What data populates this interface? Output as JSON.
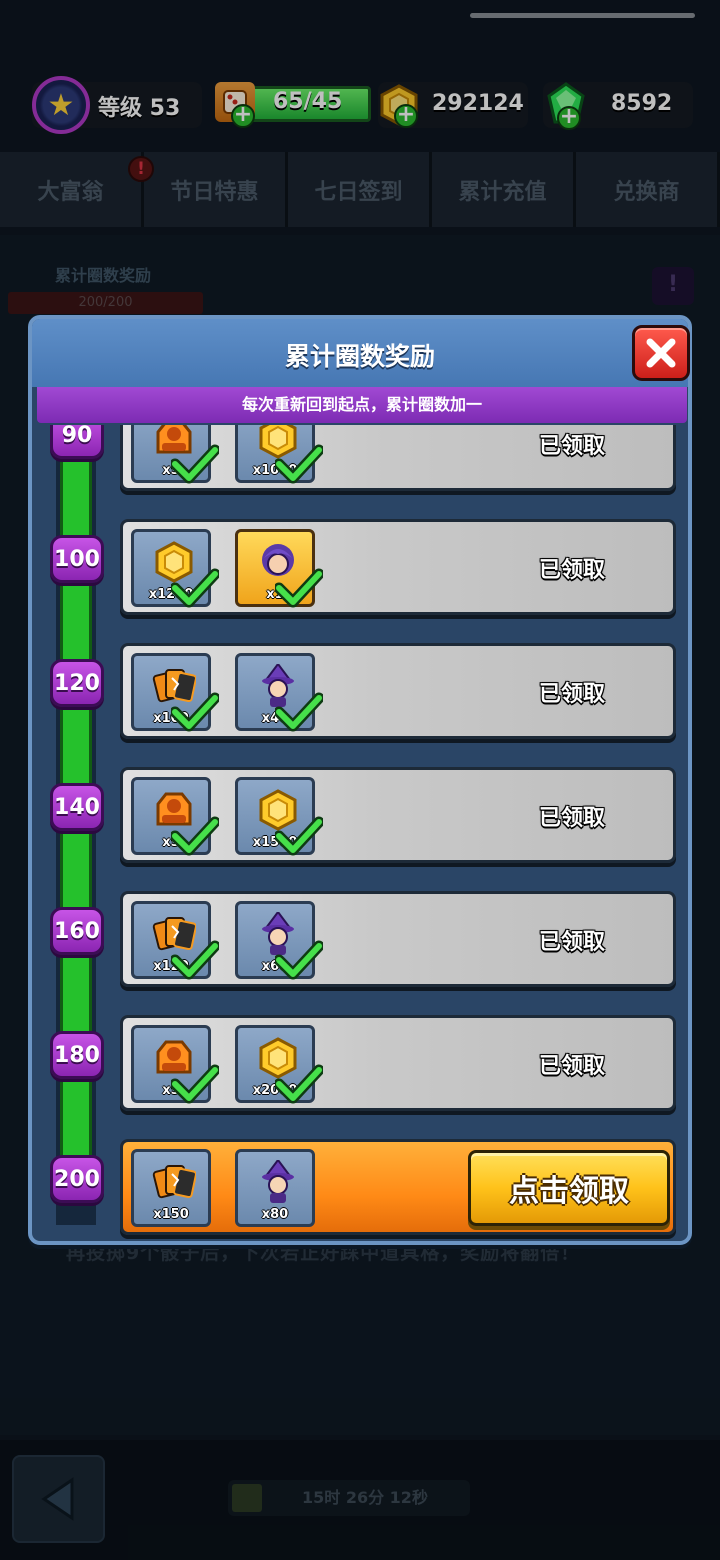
{
  "topbar": {
    "level_label": "等级 53",
    "energy": "65/45",
    "coins": "292124",
    "gems": "8592"
  },
  "tabs": [
    "大富翁",
    "节日特惠",
    "七日签到",
    "累计充值",
    "兑换商"
  ],
  "background": {
    "panel_title": "累计圈数奖励",
    "progress": "200/200",
    "hint": "再投掷9个骰子后，下次若正好踩中道具格，奖励将翻倍！",
    "timer": "15时 26分 12秒"
  },
  "modal": {
    "title": "累计圈数奖励",
    "subtitle": "每次重新回到起点，累计圈数加一",
    "rows": [
      {
        "milestone": "90",
        "items": [
          {
            "icon": "hero-card-icon",
            "qty": "x5"
          },
          {
            "icon": "gold-coin-icon",
            "qty": "x1000"
          }
        ],
        "status": "已领取"
      },
      {
        "milestone": "100",
        "items": [
          {
            "icon": "gold-coin-icon",
            "qty": "x1200"
          },
          {
            "icon": "hero-portrait-icon",
            "qty": "x1"
          }
        ],
        "status": "已领取"
      },
      {
        "milestone": "120",
        "items": [
          {
            "icon": "card-pack-icon",
            "qty": "x100"
          },
          {
            "icon": "witch-character-icon",
            "qty": "x40"
          }
        ],
        "status": "已领取"
      },
      {
        "milestone": "140",
        "items": [
          {
            "icon": "hero-card-icon",
            "qty": "x5"
          },
          {
            "icon": "gold-coin-icon",
            "qty": "x1500"
          }
        ],
        "status": "已领取"
      },
      {
        "milestone": "160",
        "items": [
          {
            "icon": "card-pack-icon",
            "qty": "x120"
          },
          {
            "icon": "witch-character-icon",
            "qty": "x60"
          }
        ],
        "status": "已领取"
      },
      {
        "milestone": "180",
        "items": [
          {
            "icon": "hero-card-icon",
            "qty": "x5"
          },
          {
            "icon": "gold-coin-icon",
            "qty": "x2000"
          }
        ],
        "status": "已领取"
      },
      {
        "milestone": "200",
        "items": [
          {
            "icon": "card-pack-icon",
            "qty": "x150"
          },
          {
            "icon": "witch-character-icon",
            "qty": "x80"
          }
        ],
        "status": "点击领取",
        "active": true
      }
    ]
  }
}
